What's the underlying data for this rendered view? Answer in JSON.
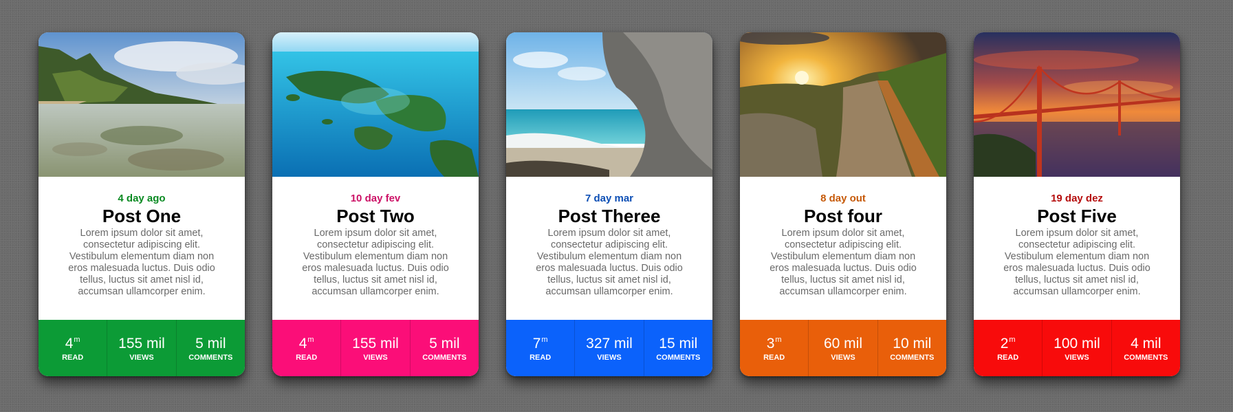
{
  "cards": [
    {
      "image": "tropical-coast-photo",
      "date": "4 day ago",
      "date_color": "#0a8a22",
      "title": "Post One",
      "text": "Lorem ipsum dolor sit amet, consectetur adipiscing elit. Vestibulum elementum diam non eros malesuada luctus. Duis odio tellus, luctus sit amet nisl id, accumsan ullamcorper enim.",
      "color": "#0c9b36",
      "stats": [
        {
          "value": "4",
          "unit": "m",
          "label": "READ"
        },
        {
          "value": "155 mil",
          "label": "VIEWS"
        },
        {
          "value": "5 mil",
          "label": "COMMENTS"
        }
      ]
    },
    {
      "image": "tropical-islands-aerial-photo",
      "date": "10 day fev",
      "date_color": "#cc1166",
      "title": "Post Two",
      "text": "Lorem ipsum dolor sit amet, consectetur adipiscing elit. Vestibulum elementum diam non eros malesuada luctus. Duis odio tellus, luctus sit amet nisl id, accumsan ullamcorper enim.",
      "color": "#fb0e78",
      "stats": [
        {
          "value": "4",
          "unit": "m",
          "label": "READ"
        },
        {
          "value": "155 mil",
          "label": "VIEWS"
        },
        {
          "value": "5 mil",
          "label": "COMMENTS"
        }
      ]
    },
    {
      "image": "sea-cave-beach-photo",
      "date": "7 day mar",
      "date_color": "#0d4fb5",
      "title": "Post Theree",
      "text": "Lorem ipsum dolor sit amet, consectetur adipiscing elit. Vestibulum elementum diam non eros malesuada luctus. Duis odio tellus, luctus sit amet nisl id, accumsan ullamcorper enim.",
      "color": "#0b62fb",
      "stats": [
        {
          "value": "7",
          "unit": "m",
          "label": "READ"
        },
        {
          "value": "327 mil",
          "label": "VIEWS"
        },
        {
          "value": "15 mil",
          "label": "COMMENTS"
        }
      ]
    },
    {
      "image": "great-wall-sunset-photo",
      "date": "8 day out",
      "date_color": "#c65a0a",
      "title": "Post four",
      "text": "Lorem ipsum dolor sit amet, consectetur adipiscing elit. Vestibulum elementum diam non eros malesuada luctus. Duis odio tellus, luctus sit amet nisl id, accumsan ullamcorper enim.",
      "color": "#e95f0a",
      "stats": [
        {
          "value": "3",
          "unit": "m",
          "label": "READ"
        },
        {
          "value": "60 mil",
          "label": "VIEWS"
        },
        {
          "value": "10 mil",
          "label": "COMMENTS"
        }
      ]
    },
    {
      "image": "golden-gate-bridge-sunset-photo",
      "date": "19 day dez",
      "date_color": "#b50d0d",
      "title": "Post Five",
      "text": "Lorem ipsum dolor sit amet, consectetur adipiscing elit. Vestibulum elementum diam non eros malesuada luctus. Duis odio tellus, luctus sit amet nisl id, accumsan ullamcorper enim.",
      "color": "#f80b0b",
      "stats": [
        {
          "value": "2",
          "unit": "m",
          "label": "READ"
        },
        {
          "value": "100 mil",
          "label": "VIEWS"
        },
        {
          "value": "4 mil",
          "label": "COMMENTS"
        }
      ]
    }
  ]
}
